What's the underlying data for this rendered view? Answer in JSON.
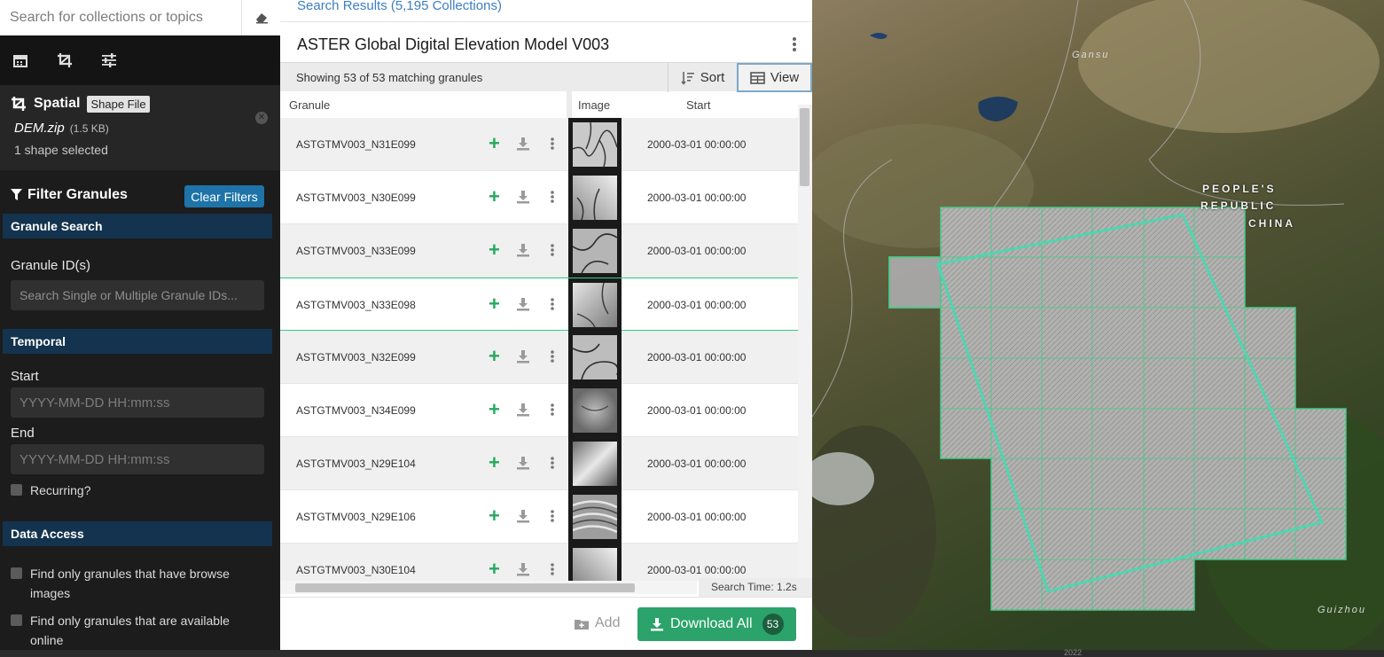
{
  "search": {
    "placeholder": "Search for collections or topics"
  },
  "spatial": {
    "title": "Spatial",
    "type_badge": "Shape File",
    "file_name": "DEM.zip",
    "file_size": "(1.5 KB)",
    "selection": "1 shape selected"
  },
  "filter": {
    "title": "Filter Granules",
    "clear_label": "Clear Filters",
    "granule_search": {
      "section": "Granule Search",
      "label": "Granule ID(s)",
      "placeholder": "Search Single or Multiple Granule IDs..."
    },
    "temporal": {
      "section": "Temporal",
      "start_label": "Start",
      "start_placeholder": "YYYY-MM-DD HH:mm:ss",
      "end_label": "End",
      "end_placeholder": "YYYY-MM-DD HH:mm:ss",
      "recurring_label": "Recurring?"
    },
    "data_access": {
      "section": "Data Access",
      "browse_line1": "Find only granules that have browse",
      "browse_line2": "images",
      "online_line1": "Find only granules that are available",
      "online_line2": "online"
    }
  },
  "results": {
    "link": "Search Results (5,195 Collections)",
    "collection_title": "ASTER Global Digital Elevation Model V003",
    "showing": "Showing 53 of 53 matching granules",
    "sort_label": "Sort",
    "view_label": "View",
    "columns": {
      "granule": "Granule",
      "image": "Image",
      "start": "Start"
    },
    "rows": [
      {
        "id": "ASTGTMV003_N31E099",
        "start": "2000-03-01 00:00:00"
      },
      {
        "id": "ASTGTMV003_N30E099",
        "start": "2000-03-01 00:00:00"
      },
      {
        "id": "ASTGTMV003_N33E099",
        "start": "2000-03-01 00:00:00"
      },
      {
        "id": "ASTGTMV003_N33E098",
        "start": "2000-03-01 00:00:00"
      },
      {
        "id": "ASTGTMV003_N32E099",
        "start": "2000-03-01 00:00:00"
      },
      {
        "id": "ASTGTMV003_N34E099",
        "start": "2000-03-01 00:00:00"
      },
      {
        "id": "ASTGTMV003_N29E104",
        "start": "2000-03-01 00:00:00"
      },
      {
        "id": "ASTGTMV003_N29E106",
        "start": "2000-03-01 00:00:00"
      },
      {
        "id": "ASTGTMV003_N30E104",
        "start": "2000-03-01 00:00:00"
      }
    ],
    "search_time": "Search Time:  1.2s",
    "add_label": "Add",
    "download_label": "Download All",
    "download_count": "53"
  },
  "map": {
    "country_line1": "PEOPLE'S",
    "country_line2": "REPUBLIC",
    "country_line3": "CHINA",
    "region_gansu": "Gansu",
    "region_guizhou": "Guizhou"
  },
  "timeline": {
    "year": "2022"
  },
  "colors": {
    "accent_green": "#2ba36a",
    "link_blue": "#3c7fc0",
    "selection_green": "#2fcf8a",
    "section_navy": "#13334e"
  }
}
